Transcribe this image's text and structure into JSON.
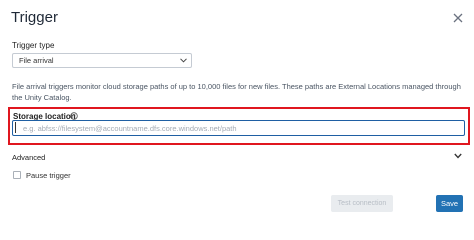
{
  "dialog": {
    "title": "Trigger"
  },
  "trigger_type": {
    "label": "Trigger type",
    "selected": "File arrival"
  },
  "description": "File arrival triggers monitor cloud storage paths of up to 10,000 files for new files. These paths are External Locations managed through the Unity Catalog.",
  "storage_location": {
    "label": "Storage location",
    "value": "",
    "placeholder": "e.g. abfss://filesystem@accountname.dfs.core.windows.net/path"
  },
  "advanced": {
    "label": "Advanced"
  },
  "pause_trigger": {
    "label": "Pause trigger",
    "checked": false
  },
  "buttons": {
    "test_connection": "Test connection",
    "save": "Save"
  },
  "colors": {
    "primary": "#2272b4",
    "highlight": "#e0161f",
    "input_focus": "#1f5fa3"
  },
  "icons": {
    "close": "close-icon",
    "select_chevron": "chevron-down-icon",
    "info": "info-icon",
    "advanced_chevron": "chevron-down-icon"
  }
}
